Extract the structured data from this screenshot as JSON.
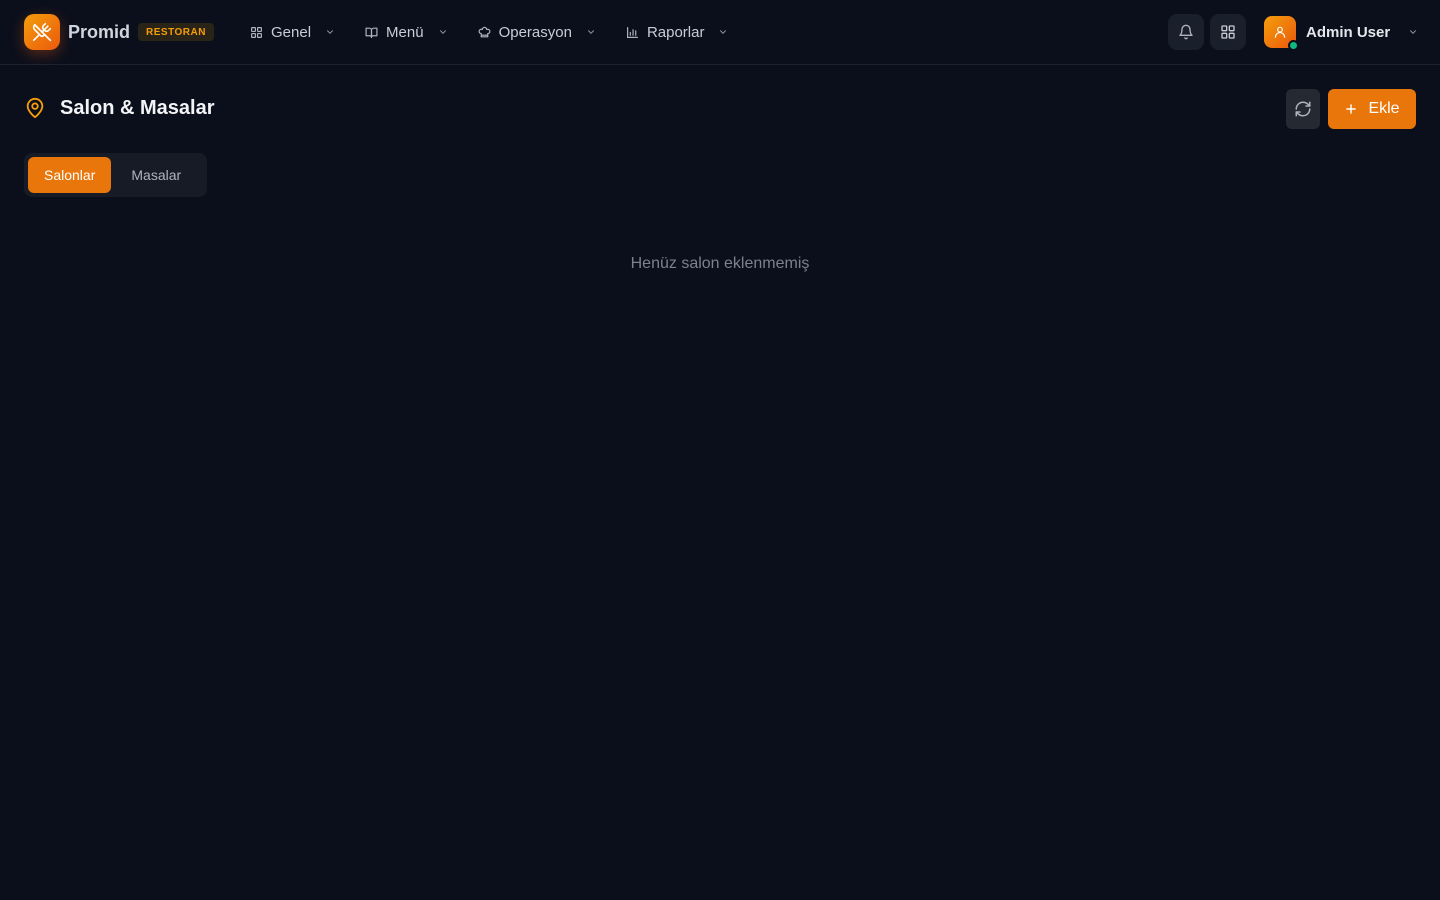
{
  "brand": {
    "name": "Promid",
    "badge": "RESTORAN",
    "logo_icon": "utensils-crossed-icon"
  },
  "nav": {
    "items": [
      {
        "label": "Genel",
        "icon": "layout-grid-icon"
      },
      {
        "label": "Menü",
        "icon": "book-open-icon"
      },
      {
        "label": "Operasyon",
        "icon": "chef-hat-icon"
      },
      {
        "label": "Raporlar",
        "icon": "bar-chart-icon"
      }
    ]
  },
  "header_actions": {
    "notifications_icon": "bell-icon",
    "apps_icon": "grid-icon"
  },
  "user": {
    "name": "Admin User",
    "status_color": "#10b981"
  },
  "page": {
    "title": "Salon & Masalar",
    "title_icon": "map-pin-icon",
    "add_label": "Ekle",
    "refresh_icon": "refresh-icon"
  },
  "tabs": [
    {
      "label": "Salonlar",
      "active": true
    },
    {
      "label": "Masalar",
      "active": false
    }
  ],
  "empty_state": {
    "message": "Henüz salon eklenmemiş"
  },
  "colors": {
    "accent": "#e8760a",
    "background": "#0b0f1c",
    "brand_gradient_start": "#f59e0b"
  }
}
